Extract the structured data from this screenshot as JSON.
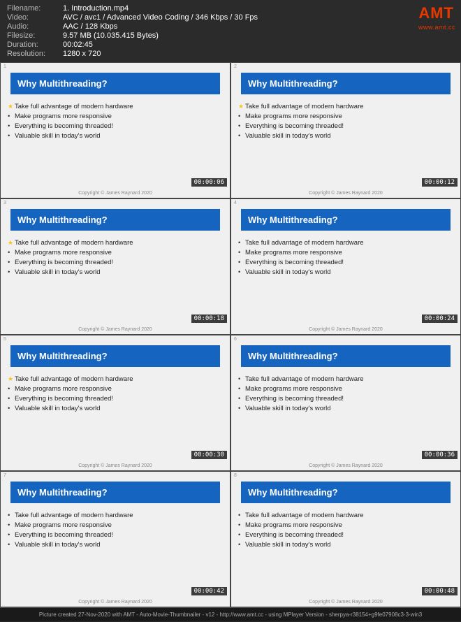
{
  "header": {
    "filename_label": "Filename:",
    "filename_value": "1. Introduction.mp4",
    "video_label": "Video:",
    "video_value": "AVC / avc1 / Advanced Video Coding / 346 Kbps / 30 Fps",
    "audio_label": "Audio:",
    "audio_value": "AAC / 128 Kbps",
    "filesize_label": "Filesize:",
    "filesize_value": "9.57 MB (10.035.415 Bytes)",
    "duration_label": "Duration:",
    "duration_value": "00:02:45",
    "resolution_label": "Resolution:",
    "resolution_value": "1280 x 720",
    "amt_logo": "AMT",
    "amt_logo_sub": "www.amt.cc"
  },
  "slides": [
    {
      "index": "1",
      "title": "Why Multithreading?",
      "bullets": [
        {
          "text": "Take full advantage of modern hardware",
          "starred": true
        },
        {
          "text": "Make programs more responsive",
          "starred": false
        },
        {
          "text": "Everything is becoming threaded!",
          "starred": false
        },
        {
          "text": "Valuable skill in today's world",
          "starred": false
        }
      ],
      "timestamp": "00:00:06",
      "copyright": "Copyright © James Raynard 2020"
    },
    {
      "index": "2",
      "title": "Why Multithreading?",
      "bullets": [
        {
          "text": "Take full advantage of modern hardware",
          "starred": true
        },
        {
          "text": "Make programs more responsive",
          "starred": false
        },
        {
          "text": "Everything is becoming threaded!",
          "starred": false
        },
        {
          "text": "Valuable skill in today's world",
          "starred": false
        }
      ],
      "timestamp": "00:00:12",
      "copyright": "Copyright © James Raynard 2020"
    },
    {
      "index": "3",
      "title": "Why Multithreading?",
      "bullets": [
        {
          "text": "Take full advantage of modern hardware",
          "starred": true
        },
        {
          "text": "Make programs more responsive",
          "starred": false
        },
        {
          "text": "Everything is becoming threaded!",
          "starred": false
        },
        {
          "text": "Valuable skill in today's world",
          "starred": false
        }
      ],
      "timestamp": "00:00:18",
      "copyright": "Copyright © James Raynard 2020"
    },
    {
      "index": "4",
      "title": "Why Multithreading?",
      "bullets": [
        {
          "text": "Take full advantage of modern hardware",
          "starred": false
        },
        {
          "text": "Make programs more responsive",
          "starred": false
        },
        {
          "text": "Everything is becoming threaded!",
          "starred": false
        },
        {
          "text": "Valuable skill in today's world",
          "starred": false
        }
      ],
      "timestamp": "00:00:24",
      "copyright": "Copyright © James Raynard 2020"
    },
    {
      "index": "5",
      "title": "Why Multithreading?",
      "bullets": [
        {
          "text": "Take full advantage of modern hardware",
          "starred": true
        },
        {
          "text": "Make programs more responsive",
          "starred": false
        },
        {
          "text": "Everything is becoming threaded!",
          "starred": false
        },
        {
          "text": "Valuable skill in today's world",
          "starred": false
        }
      ],
      "timestamp": "00:00:30",
      "copyright": "Copyright © James Raynard 2020"
    },
    {
      "index": "6",
      "title": "Why Multithreading?",
      "bullets": [
        {
          "text": "Take full advantage of modern hardware",
          "starred": false
        },
        {
          "text": "Make programs more responsive",
          "starred": false
        },
        {
          "text": "Everything is becoming threaded!",
          "starred": false
        },
        {
          "text": "Valuable skill in today's world",
          "starred": false
        }
      ],
      "timestamp": "00:00:36",
      "copyright": "Copyright © James Raynard 2020"
    },
    {
      "index": "7",
      "title": "Why Multithreading?",
      "bullets": [
        {
          "text": "Take full advantage of modern hardware",
          "starred": false
        },
        {
          "text": "Make programs more responsive",
          "starred": false
        },
        {
          "text": "Everything is becoming threaded!",
          "starred": false
        },
        {
          "text": "Valuable skill in today's world",
          "starred": false
        }
      ],
      "timestamp": "00:00:42",
      "copyright": "Copyright © James Raynard 2020"
    },
    {
      "index": "8",
      "title": "Why Multithreading?",
      "bullets": [
        {
          "text": "Take full advantage of modern hardware",
          "starred": false
        },
        {
          "text": "Make programs more responsive",
          "starred": false
        },
        {
          "text": "Everything is becoming threaded!",
          "starred": false
        },
        {
          "text": "Valuable skill in today's world",
          "starred": false
        }
      ],
      "timestamp": "00:00:48",
      "copyright": "Copyright © James Raynard 2020"
    }
  ],
  "footer": {
    "text": "Picture created 27-Nov-2020 with AMT - Auto-Movie-Thumbnailer - v12 - http://www.amt.cc - using MPlayer Version - sherpya-r38154+g9fe07908c3-3-win3"
  }
}
